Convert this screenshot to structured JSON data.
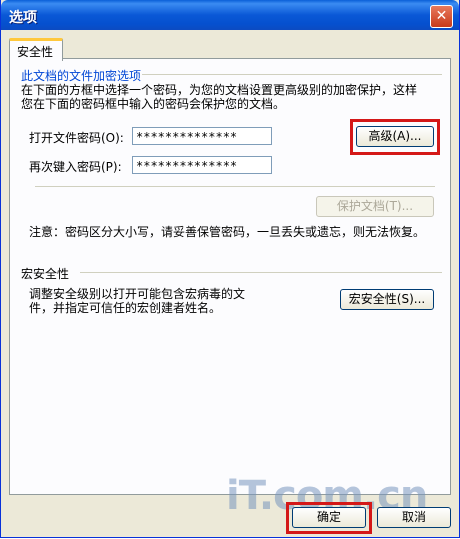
{
  "window": {
    "title": "选项",
    "close_glyph": "✕"
  },
  "tabs": [
    {
      "label": "安全性"
    }
  ],
  "encrypt": {
    "section_title": "此文档的文件加密选项",
    "description_line1": "在下面的方框中选择一个密码，为您的文档设置更高级别的加密保护，这样",
    "description_line2": "您在下面的密码框中输入的密码会保护您的文档。",
    "open_password_label": "打开文件密码(O):",
    "open_password_value": "**************",
    "reenter_password_label": "再次键入密码(P):",
    "reenter_password_value": "**************",
    "advanced_button": "高级(A)...",
    "protect_document_button": "保护文档(T)...",
    "note": "注意：密码区分大小写，请妥善保管密码，一旦丢失或遗忘，则无法恢复。"
  },
  "macro": {
    "section_title": "宏安全性",
    "description_line1": "调整安全级别以打开可能包含宏病毒的文",
    "description_line2": "件，并指定可信任的宏创建者姓名。",
    "macro_security_button": "宏安全性(S)..."
  },
  "footer": {
    "ok_button": "确定",
    "cancel_button": "取消"
  },
  "watermark": "iT.com.cn",
  "colors": {
    "highlight_box": "#d41818",
    "section_title": "#0046d5",
    "titlebar": "#0a58d6"
  }
}
